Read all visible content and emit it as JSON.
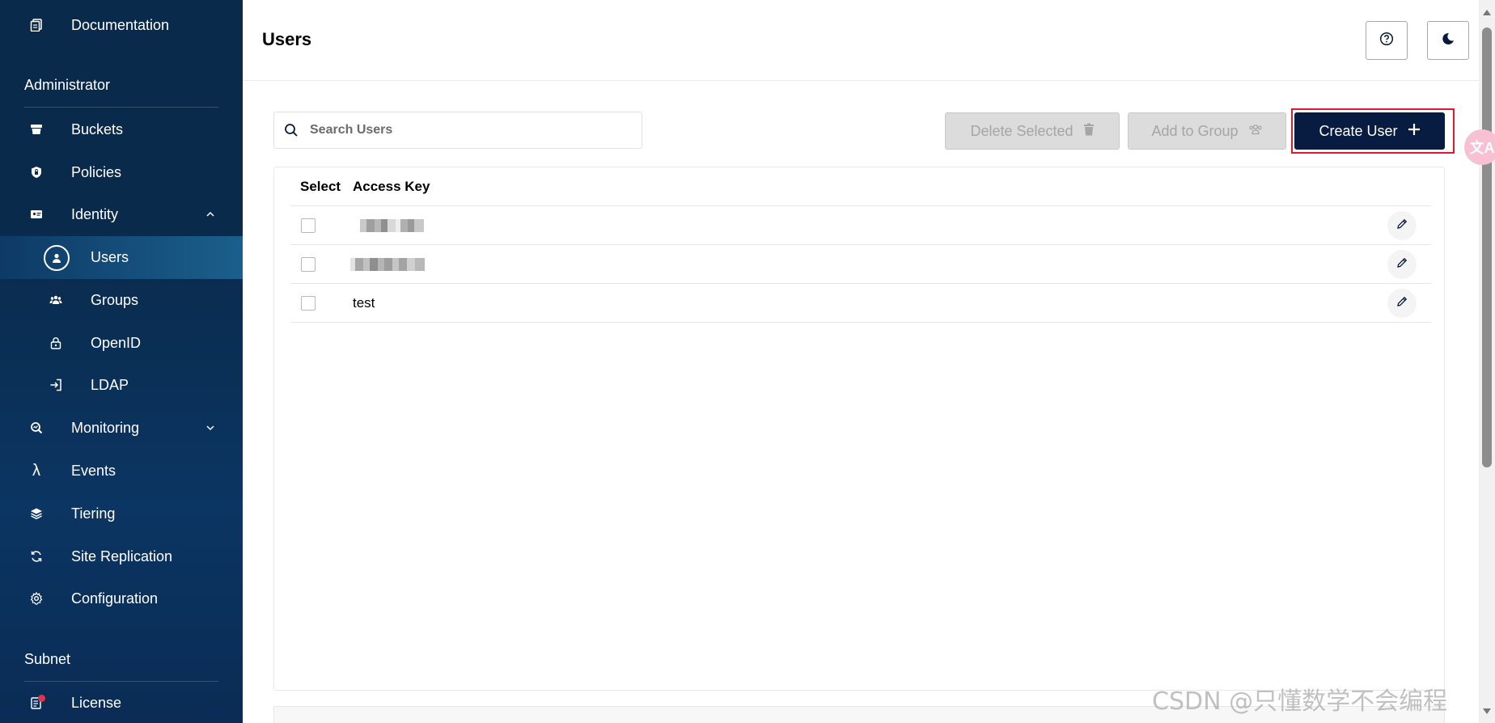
{
  "sidebar": {
    "documentation_label": "Documentation",
    "administrator_title": "Administrator",
    "items": {
      "buckets": "Buckets",
      "policies": "Policies",
      "identity": "Identity",
      "users": "Users",
      "groups": "Groups",
      "openid": "OpenID",
      "ldap": "LDAP",
      "monitoring": "Monitoring",
      "events": "Events",
      "tiering": "Tiering",
      "site_replication": "Site Replication",
      "configuration": "Configuration"
    },
    "subnet_title": "Subnet",
    "license_label": "License",
    "events_glyph": "λ"
  },
  "header": {
    "title": "Users",
    "help_icon": "help-icon",
    "theme_icon": "moon-icon"
  },
  "toolbar": {
    "search_placeholder": "Search Users",
    "delete_label": "Delete Selected",
    "add_group_label": "Add to Group",
    "create_label": "Create User"
  },
  "table": {
    "columns": [
      "Select",
      "Access Key"
    ],
    "rows": [
      {
        "access_key": "",
        "redacted": true
      },
      {
        "access_key": "",
        "redacted": true
      },
      {
        "access_key": "test",
        "redacted": false
      }
    ]
  },
  "overlay": {
    "translate_glyph": "文A",
    "watermark": "CSDN @只懂数学不会编程"
  },
  "colors": {
    "sidebar_bg": "#0a2a4b",
    "primary_button": "#081c42",
    "highlight": "#e0182d"
  }
}
